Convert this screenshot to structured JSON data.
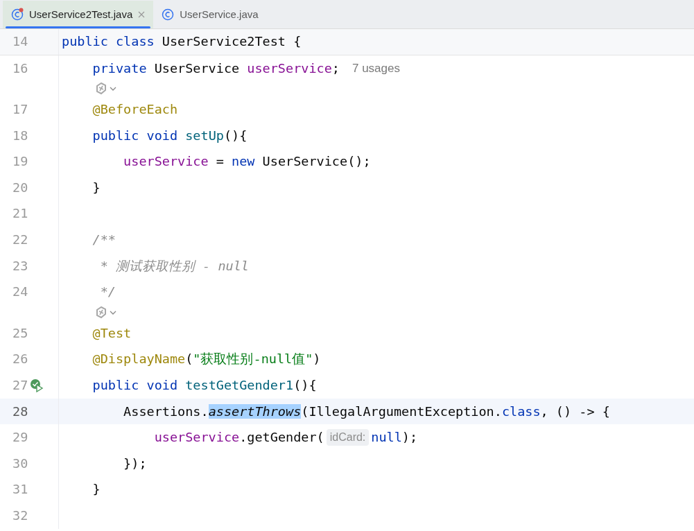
{
  "tabs": [
    {
      "label": "UserService2Test.java",
      "selected": true,
      "closable": true,
      "modified": true
    },
    {
      "label": "UserService.java",
      "selected": false,
      "closable": false,
      "modified": false
    }
  ],
  "lines": [
    {
      "kind": "code",
      "number": "14",
      "sticky": true,
      "current": false,
      "run_icon": false,
      "tokens": [
        {
          "t": "public class ",
          "kind": "kw"
        },
        {
          "t": "UserService2Test {",
          "kind": "plain"
        }
      ]
    },
    {
      "kind": "code",
      "number": "16",
      "sticky": false,
      "current": false,
      "run_icon": false,
      "tokens": [
        {
          "t": "    private ",
          "kind": "kw"
        },
        {
          "t": "UserService ",
          "kind": "plain"
        },
        {
          "t": "userService",
          "kind": "field"
        },
        {
          "t": ";",
          "kind": "plain"
        },
        {
          "t": "7 usages",
          "kind": "usages"
        }
      ]
    },
    {
      "kind": "inlay"
    },
    {
      "kind": "code",
      "number": "17",
      "sticky": false,
      "current": false,
      "run_icon": false,
      "tokens": [
        {
          "t": "    @BeforeEach",
          "kind": "anno"
        }
      ]
    },
    {
      "kind": "code",
      "number": "18",
      "sticky": false,
      "current": false,
      "run_icon": false,
      "tokens": [
        {
          "t": "    public void ",
          "kind": "kw"
        },
        {
          "t": "setUp",
          "kind": "method"
        },
        {
          "t": "(){",
          "kind": "plain"
        }
      ]
    },
    {
      "kind": "code",
      "number": "19",
      "sticky": false,
      "current": false,
      "run_icon": false,
      "tokens": [
        {
          "t": "        userService",
          "kind": "field"
        },
        {
          "t": " = ",
          "kind": "plain"
        },
        {
          "t": "new ",
          "kind": "kw"
        },
        {
          "t": "UserService();",
          "kind": "plain"
        }
      ]
    },
    {
      "kind": "code",
      "number": "20",
      "sticky": false,
      "current": false,
      "run_icon": false,
      "tokens": [
        {
          "t": "    }",
          "kind": "plain"
        }
      ]
    },
    {
      "kind": "code",
      "number": "21",
      "sticky": false,
      "current": false,
      "run_icon": false
    },
    {
      "kind": "code",
      "number": "22",
      "sticky": false,
      "current": false,
      "run_icon": false,
      "tokens": [
        {
          "t": "    /**",
          "kind": "comment"
        }
      ]
    },
    {
      "kind": "code",
      "number": "23",
      "sticky": false,
      "current": false,
      "run_icon": false,
      "tokens": [
        {
          "t": "     * 测试获取性别 - null",
          "kind": "comment"
        }
      ]
    },
    {
      "kind": "code",
      "number": "24",
      "sticky": false,
      "current": false,
      "run_icon": false,
      "tokens": [
        {
          "t": "     */",
          "kind": "comment"
        }
      ]
    },
    {
      "kind": "inlay"
    },
    {
      "kind": "code",
      "number": "25",
      "sticky": false,
      "current": false,
      "run_icon": false,
      "tokens": [
        {
          "t": "    @Test",
          "kind": "anno"
        }
      ]
    },
    {
      "kind": "code",
      "number": "26",
      "sticky": false,
      "current": false,
      "run_icon": false,
      "tokens": [
        {
          "t": "    @DisplayName",
          "kind": "anno"
        },
        {
          "t": "(",
          "kind": "plain"
        },
        {
          "t": "\"获取性别-null值\"",
          "kind": "string"
        },
        {
          "t": ")",
          "kind": "plain"
        }
      ]
    },
    {
      "kind": "code",
      "number": "27",
      "sticky": false,
      "current": false,
      "run_icon": true,
      "tokens": [
        {
          "t": "    public void ",
          "kind": "kw"
        },
        {
          "t": "testGetGender1",
          "kind": "method"
        },
        {
          "t": "(){",
          "kind": "plain"
        }
      ]
    },
    {
      "kind": "code",
      "number": "28",
      "sticky": false,
      "current": true,
      "run_icon": false,
      "tokens": [
        {
          "t": "        Assertions.",
          "kind": "plain"
        },
        {
          "t": "assertThrows",
          "kind": "static",
          "selected": true
        },
        {
          "t": "(IllegalArgumentException.",
          "kind": "plain"
        },
        {
          "t": "class",
          "kind": "kw"
        },
        {
          "t": ", () -> {",
          "kind": "plain"
        }
      ]
    },
    {
      "kind": "code",
      "number": "29",
      "sticky": false,
      "current": false,
      "run_icon": false,
      "tokens": [
        {
          "t": "            userService",
          "kind": "field"
        },
        {
          "t": ".getGender(",
          "kind": "plain"
        },
        {
          "t": "idCard:",
          "kind": "hint"
        },
        {
          "t": "null",
          "kind": "kw"
        },
        {
          "t": ");",
          "kind": "plain"
        }
      ]
    },
    {
      "kind": "code",
      "number": "30",
      "sticky": false,
      "current": false,
      "run_icon": false,
      "tokens": [
        {
          "t": "        });",
          "kind": "plain"
        }
      ]
    },
    {
      "kind": "code",
      "number": "31",
      "sticky": false,
      "current": false,
      "run_icon": false,
      "tokens": [
        {
          "t": "    }",
          "kind": "plain"
        }
      ]
    },
    {
      "kind": "code",
      "number": "32",
      "sticky": false,
      "current": false,
      "run_icon": false
    }
  ]
}
